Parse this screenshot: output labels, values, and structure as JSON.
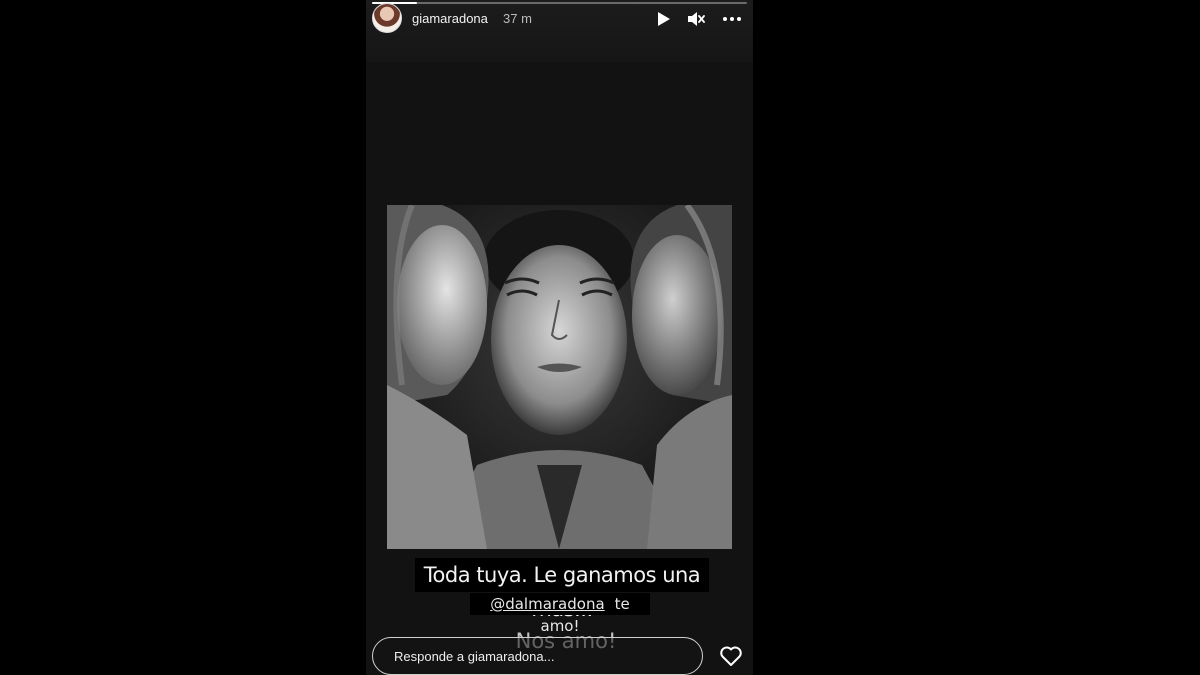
{
  "story": {
    "username": "giamaradona",
    "time_ago": "37 m",
    "progress": 0.12
  },
  "controls": {
    "play_icon": "play-icon",
    "mute_icon": "speaker-muted-icon",
    "more_icon": "more-dots-icon"
  },
  "captions": {
    "line1": "Toda tuya. Le ganamos una más...",
    "mention": "@dalmaradona",
    "line2_rest": "te amo!",
    "line3": "Nos amo!"
  },
  "reply": {
    "placeholder": "Responde a giamaradona..."
  },
  "colors": {
    "background": "#000000",
    "story_bg": "#121212",
    "text": "#f2f2f2"
  }
}
